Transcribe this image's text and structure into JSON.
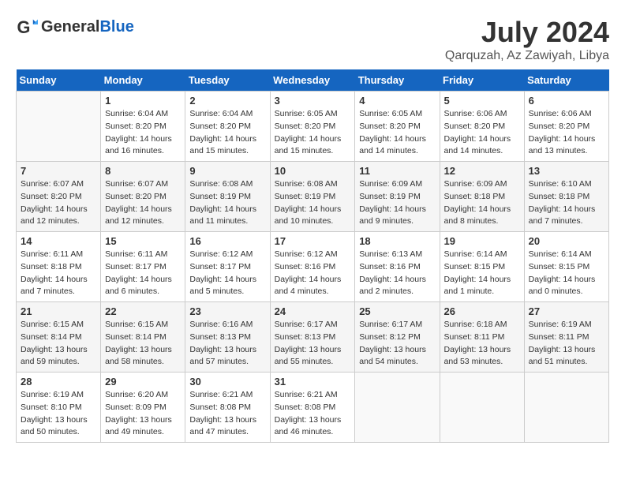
{
  "header": {
    "logo_general": "General",
    "logo_blue": "Blue",
    "month": "July 2024",
    "location": "Qarquzah, Az Zawiyah, Libya"
  },
  "days_of_week": [
    "Sunday",
    "Monday",
    "Tuesday",
    "Wednesday",
    "Thursday",
    "Friday",
    "Saturday"
  ],
  "weeks": [
    [
      {
        "day": "",
        "sunrise": "",
        "sunset": "",
        "daylight": ""
      },
      {
        "day": "1",
        "sunrise": "6:04 AM",
        "sunset": "8:20 PM",
        "daylight": "14 hours and 16 minutes."
      },
      {
        "day": "2",
        "sunrise": "6:04 AM",
        "sunset": "8:20 PM",
        "daylight": "14 hours and 15 minutes."
      },
      {
        "day": "3",
        "sunrise": "6:05 AM",
        "sunset": "8:20 PM",
        "daylight": "14 hours and 15 minutes."
      },
      {
        "day": "4",
        "sunrise": "6:05 AM",
        "sunset": "8:20 PM",
        "daylight": "14 hours and 14 minutes."
      },
      {
        "day": "5",
        "sunrise": "6:06 AM",
        "sunset": "8:20 PM",
        "daylight": "14 hours and 14 minutes."
      },
      {
        "day": "6",
        "sunrise": "6:06 AM",
        "sunset": "8:20 PM",
        "daylight": "14 hours and 13 minutes."
      }
    ],
    [
      {
        "day": "7",
        "sunrise": "6:07 AM",
        "sunset": "8:20 PM",
        "daylight": "14 hours and 12 minutes."
      },
      {
        "day": "8",
        "sunrise": "6:07 AM",
        "sunset": "8:20 PM",
        "daylight": "14 hours and 12 minutes."
      },
      {
        "day": "9",
        "sunrise": "6:08 AM",
        "sunset": "8:19 PM",
        "daylight": "14 hours and 11 minutes."
      },
      {
        "day": "10",
        "sunrise": "6:08 AM",
        "sunset": "8:19 PM",
        "daylight": "14 hours and 10 minutes."
      },
      {
        "day": "11",
        "sunrise": "6:09 AM",
        "sunset": "8:19 PM",
        "daylight": "14 hours and 9 minutes."
      },
      {
        "day": "12",
        "sunrise": "6:09 AM",
        "sunset": "8:18 PM",
        "daylight": "14 hours and 8 minutes."
      },
      {
        "day": "13",
        "sunrise": "6:10 AM",
        "sunset": "8:18 PM",
        "daylight": "14 hours and 7 minutes."
      }
    ],
    [
      {
        "day": "14",
        "sunrise": "6:11 AM",
        "sunset": "8:18 PM",
        "daylight": "14 hours and 7 minutes."
      },
      {
        "day": "15",
        "sunrise": "6:11 AM",
        "sunset": "8:17 PM",
        "daylight": "14 hours and 6 minutes."
      },
      {
        "day": "16",
        "sunrise": "6:12 AM",
        "sunset": "8:17 PM",
        "daylight": "14 hours and 5 minutes."
      },
      {
        "day": "17",
        "sunrise": "6:12 AM",
        "sunset": "8:16 PM",
        "daylight": "14 hours and 4 minutes."
      },
      {
        "day": "18",
        "sunrise": "6:13 AM",
        "sunset": "8:16 PM",
        "daylight": "14 hours and 2 minutes."
      },
      {
        "day": "19",
        "sunrise": "6:14 AM",
        "sunset": "8:15 PM",
        "daylight": "14 hours and 1 minute."
      },
      {
        "day": "20",
        "sunrise": "6:14 AM",
        "sunset": "8:15 PM",
        "daylight": "14 hours and 0 minutes."
      }
    ],
    [
      {
        "day": "21",
        "sunrise": "6:15 AM",
        "sunset": "8:14 PM",
        "daylight": "13 hours and 59 minutes."
      },
      {
        "day": "22",
        "sunrise": "6:15 AM",
        "sunset": "8:14 PM",
        "daylight": "13 hours and 58 minutes."
      },
      {
        "day": "23",
        "sunrise": "6:16 AM",
        "sunset": "8:13 PM",
        "daylight": "13 hours and 57 minutes."
      },
      {
        "day": "24",
        "sunrise": "6:17 AM",
        "sunset": "8:13 PM",
        "daylight": "13 hours and 55 minutes."
      },
      {
        "day": "25",
        "sunrise": "6:17 AM",
        "sunset": "8:12 PM",
        "daylight": "13 hours and 54 minutes."
      },
      {
        "day": "26",
        "sunrise": "6:18 AM",
        "sunset": "8:11 PM",
        "daylight": "13 hours and 53 minutes."
      },
      {
        "day": "27",
        "sunrise": "6:19 AM",
        "sunset": "8:11 PM",
        "daylight": "13 hours and 51 minutes."
      }
    ],
    [
      {
        "day": "28",
        "sunrise": "6:19 AM",
        "sunset": "8:10 PM",
        "daylight": "13 hours and 50 minutes."
      },
      {
        "day": "29",
        "sunrise": "6:20 AM",
        "sunset": "8:09 PM",
        "daylight": "13 hours and 49 minutes."
      },
      {
        "day": "30",
        "sunrise": "6:21 AM",
        "sunset": "8:08 PM",
        "daylight": "13 hours and 47 minutes."
      },
      {
        "day": "31",
        "sunrise": "6:21 AM",
        "sunset": "8:08 PM",
        "daylight": "13 hours and 46 minutes."
      },
      {
        "day": "",
        "sunrise": "",
        "sunset": "",
        "daylight": ""
      },
      {
        "day": "",
        "sunrise": "",
        "sunset": "",
        "daylight": ""
      },
      {
        "day": "",
        "sunrise": "",
        "sunset": "",
        "daylight": ""
      }
    ]
  ],
  "labels": {
    "sunrise": "Sunrise:",
    "sunset": "Sunset:",
    "daylight": "Daylight:"
  }
}
